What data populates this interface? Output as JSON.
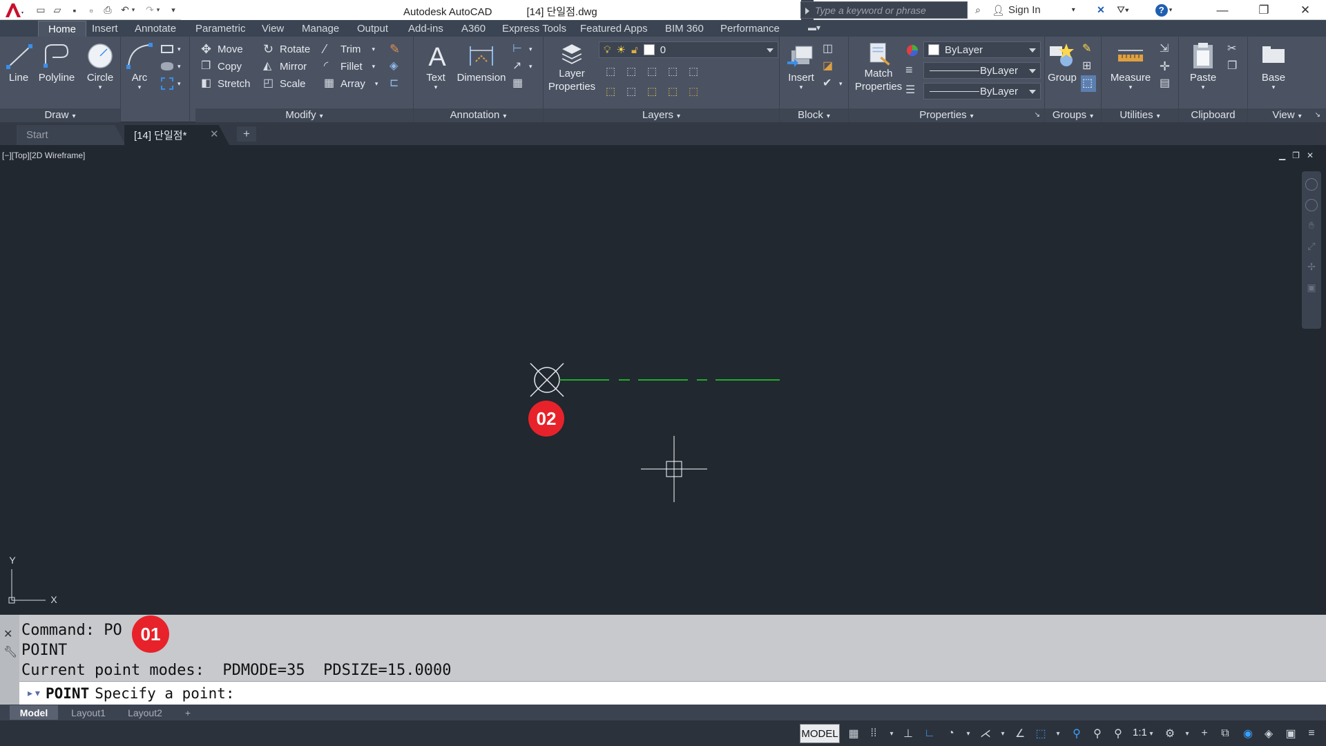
{
  "titlebar": {
    "app_name": "Autodesk AutoCAD",
    "file_name": "[14] 단일점.dwg",
    "search_placeholder": "Type a keyword or phrase",
    "sign_in": "Sign In"
  },
  "ribbon_tabs": [
    "Home",
    "Insert",
    "Annotate",
    "Parametric",
    "View",
    "Manage",
    "Output",
    "Add-ins",
    "A360",
    "Express Tools",
    "Featured Apps",
    "BIM 360",
    "Performance"
  ],
  "ribbon": {
    "draw": {
      "title": "Draw",
      "line": "Line",
      "polyline": "Polyline",
      "circle": "Circle",
      "arc": "Arc"
    },
    "modify": {
      "title": "Modify",
      "move": "Move",
      "rotate": "Rotate",
      "trim": "Trim",
      "copy": "Copy",
      "mirror": "Mirror",
      "fillet": "Fillet",
      "stretch": "Stretch",
      "scale": "Scale",
      "array": "Array"
    },
    "annotation": {
      "title": "Annotation",
      "text": "Text",
      "dimension": "Dimension"
    },
    "layers": {
      "title": "Layers",
      "layer_properties_1": "Layer",
      "layer_properties_2": "Properties",
      "current_layer": "0"
    },
    "block": {
      "title": "Block",
      "insert": "Insert"
    },
    "properties": {
      "title": "Properties",
      "match_1": "Match",
      "match_2": "Properties",
      "color": "ByLayer",
      "linetype": "ByLayer",
      "lineweight": "ByLayer"
    },
    "groups": {
      "title": "Groups",
      "group": "Group"
    },
    "utilities": {
      "title": "Utilities",
      "measure": "Measure"
    },
    "clipboard": {
      "title": "Clipboard",
      "paste": "Paste"
    },
    "view": {
      "title": "View",
      "base": "Base"
    }
  },
  "file_tabs": {
    "start": "Start",
    "current": "[14] 단일점*"
  },
  "viewport": {
    "label": "[−][Top][2D Wireframe]",
    "ucs_y": "Y",
    "ucs_x": "X"
  },
  "badges": {
    "step1": "01",
    "step2": "02"
  },
  "command": {
    "history": [
      "Command: PO",
      "POINT",
      "Current point modes:  PDMODE=35  PDSIZE=15.0000"
    ],
    "prefix": "▸ ▾",
    "current_command": "POINT",
    "prompt": "Specify a point:"
  },
  "layout_tabs": [
    "Model",
    "Layout1",
    "Layout2"
  ],
  "status": {
    "model": "MODEL",
    "scale": "1:1"
  },
  "colors": {
    "canvas": "#212830",
    "ribbon": "#4b5363",
    "badge": "#e8222a",
    "center_line": "#1fae2a"
  }
}
